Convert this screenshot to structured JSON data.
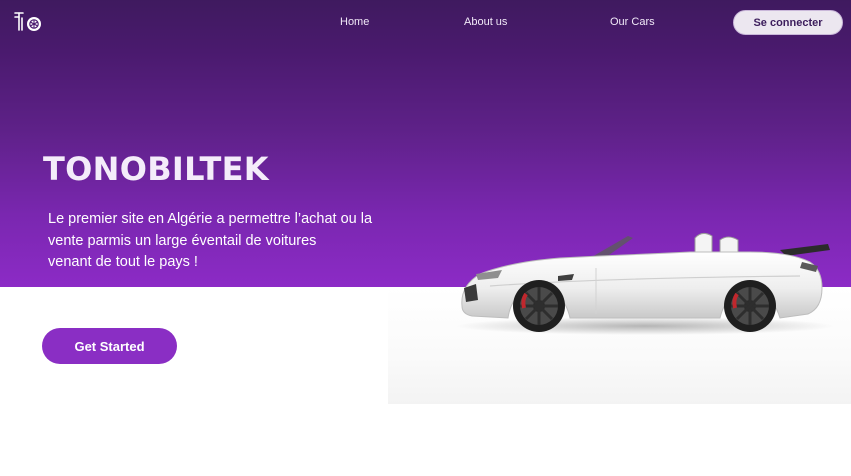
{
  "nav": {
    "logo_icon": "tonobiltek-logo-icon",
    "links": [
      "Home",
      "About us",
      "Our Cars"
    ],
    "login_label": "Se connecter"
  },
  "hero": {
    "title": "TONOBILTEK",
    "tagline_lines": [
      "Le premier site en Algérie a permettre l’achat ou la",
      "vente parmis un large éventail de voitures",
      "venant de tout le pays !"
    ],
    "cta_label": "Get Started",
    "image": "white-convertible-sports-car"
  },
  "colors": {
    "hero_top": "#3f1a5f",
    "hero_bottom": "#8c2bc6",
    "accent": "#8a2ec4",
    "login_bg": "#ece7f0"
  }
}
